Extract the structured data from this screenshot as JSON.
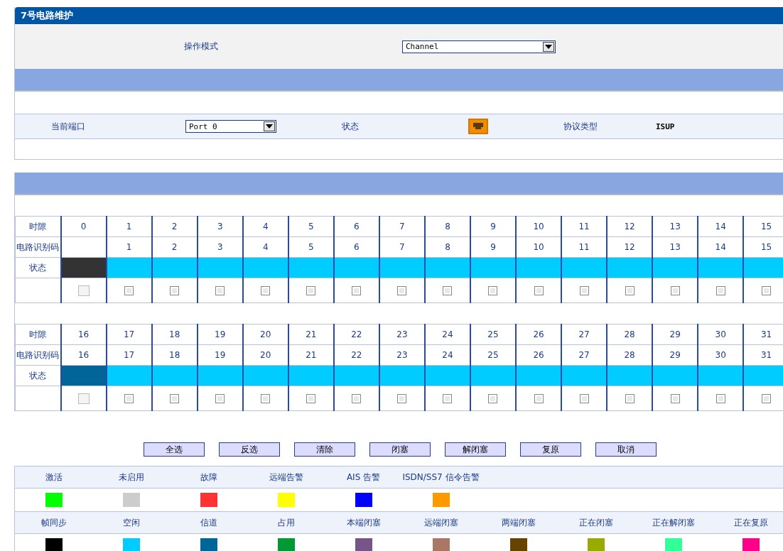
{
  "panel": {
    "title": "7号电路维护"
  },
  "mode": {
    "label": "操作模式",
    "value": "Channel"
  },
  "port_row": {
    "port_label": "当前端口",
    "port_value": "Port 0",
    "status_label": "状态",
    "protocol_label": "协议类型",
    "protocol_value": "ISUP"
  },
  "slot_groups": [
    {
      "row_labels": [
        "时隙",
        "电路识别码",
        "状态"
      ],
      "slots": [
        {
          "timeslot": "0",
          "color": "#333333",
          "checked": false,
          "disabled": true
        },
        {
          "timeslot": "1",
          "cic": "1",
          "color": "#00ccff",
          "checked": false,
          "disabled": false
        },
        {
          "timeslot": "2",
          "cic": "2",
          "color": "#00ccff",
          "checked": false,
          "disabled": false
        },
        {
          "timeslot": "3",
          "cic": "3",
          "color": "#00ccff",
          "checked": false,
          "disabled": false
        },
        {
          "timeslot": "4",
          "cic": "4",
          "color": "#00ccff",
          "checked": false,
          "disabled": false
        },
        {
          "timeslot": "5",
          "cic": "5",
          "color": "#00ccff",
          "checked": false,
          "disabled": false
        },
        {
          "timeslot": "6",
          "cic": "6",
          "color": "#00ccff",
          "checked": false,
          "disabled": false
        },
        {
          "timeslot": "7",
          "cic": "7",
          "color": "#00ccff",
          "checked": false,
          "disabled": false
        },
        {
          "timeslot": "8",
          "cic": "8",
          "color": "#00ccff",
          "checked": false,
          "disabled": false
        },
        {
          "timeslot": "9",
          "cic": "9",
          "color": "#00ccff",
          "checked": false,
          "disabled": false
        },
        {
          "timeslot": "10",
          "cic": "10",
          "color": "#00ccff",
          "checked": false,
          "disabled": false
        },
        {
          "timeslot": "11",
          "cic": "11",
          "color": "#00ccff",
          "checked": false,
          "disabled": false
        },
        {
          "timeslot": "12",
          "cic": "12",
          "color": "#00ccff",
          "checked": false,
          "disabled": false
        },
        {
          "timeslot": "13",
          "cic": "13",
          "color": "#00ccff",
          "checked": false,
          "disabled": false
        },
        {
          "timeslot": "14",
          "cic": "14",
          "color": "#00ccff",
          "checked": false,
          "disabled": false
        },
        {
          "timeslot": "15",
          "cic": "15",
          "color": "#00ccff",
          "checked": false,
          "disabled": false
        }
      ]
    },
    {
      "row_labels": [
        "时隙",
        "电路识别码",
        "状态"
      ],
      "slots": [
        {
          "timeslot": "16",
          "cic": "16",
          "color": "#006699",
          "checked": false,
          "disabled": true
        },
        {
          "timeslot": "17",
          "cic": "17",
          "color": "#00ccff",
          "checked": false,
          "disabled": false
        },
        {
          "timeslot": "18",
          "cic": "18",
          "color": "#00ccff",
          "checked": false,
          "disabled": false
        },
        {
          "timeslot": "19",
          "cic": "19",
          "color": "#00ccff",
          "checked": false,
          "disabled": false
        },
        {
          "timeslot": "20",
          "cic": "20",
          "color": "#00ccff",
          "checked": false,
          "disabled": false
        },
        {
          "timeslot": "21",
          "cic": "21",
          "color": "#00ccff",
          "checked": false,
          "disabled": false
        },
        {
          "timeslot": "22",
          "cic": "22",
          "color": "#00ccff",
          "checked": false,
          "disabled": false
        },
        {
          "timeslot": "23",
          "cic": "23",
          "color": "#00ccff",
          "checked": false,
          "disabled": false
        },
        {
          "timeslot": "24",
          "cic": "24",
          "color": "#00ccff",
          "checked": false,
          "disabled": false
        },
        {
          "timeslot": "25",
          "cic": "25",
          "color": "#00ccff",
          "checked": false,
          "disabled": false
        },
        {
          "timeslot": "26",
          "cic": "26",
          "color": "#00ccff",
          "checked": false,
          "disabled": false
        },
        {
          "timeslot": "27",
          "cic": "27",
          "color": "#00ccff",
          "checked": false,
          "disabled": false
        },
        {
          "timeslot": "28",
          "cic": "28",
          "color": "#00ccff",
          "checked": false,
          "disabled": false
        },
        {
          "timeslot": "29",
          "cic": "29",
          "color": "#00ccff",
          "checked": false,
          "disabled": false
        },
        {
          "timeslot": "30",
          "cic": "30",
          "color": "#00ccff",
          "checked": false,
          "disabled": false
        },
        {
          "timeslot": "31",
          "cic": "31",
          "color": "#00ccff",
          "checked": false,
          "disabled": false
        }
      ]
    }
  ],
  "buttons": [
    "全选",
    "反选",
    "清除",
    "闭塞",
    "解闭塞",
    "复原",
    "取消"
  ],
  "legend_rows": [
    {
      "items": [
        {
          "label": "激活",
          "color": "#00ff00"
        },
        {
          "label": "未启用",
          "color": "#cccccc"
        },
        {
          "label": "故障",
          "color": "#ff3333"
        },
        {
          "label": "远端告警",
          "color": "#ffff00"
        },
        {
          "label": "AIS 告警",
          "color": "#0000ff"
        },
        {
          "label": "ISDN/SS7 信令告警",
          "color": "#ff9900"
        }
      ]
    },
    {
      "items": [
        {
          "label": "帧同步",
          "color": "#000000"
        },
        {
          "label": "空闲",
          "color": "#00ccff"
        },
        {
          "label": "信道",
          "color": "#006699"
        },
        {
          "label": "占用",
          "color": "#009933"
        },
        {
          "label": "本端闭塞",
          "color": "#775588"
        },
        {
          "label": "远端闭塞",
          "color": "#aa7766"
        },
        {
          "label": "两端闭塞",
          "color": "#664400"
        },
        {
          "label": "正在闭塞",
          "color": "#99aa00"
        },
        {
          "label": "正在解闭塞",
          "color": "#33ff99"
        },
        {
          "label": "正在复原",
          "color": "#ff0088"
        }
      ]
    }
  ]
}
